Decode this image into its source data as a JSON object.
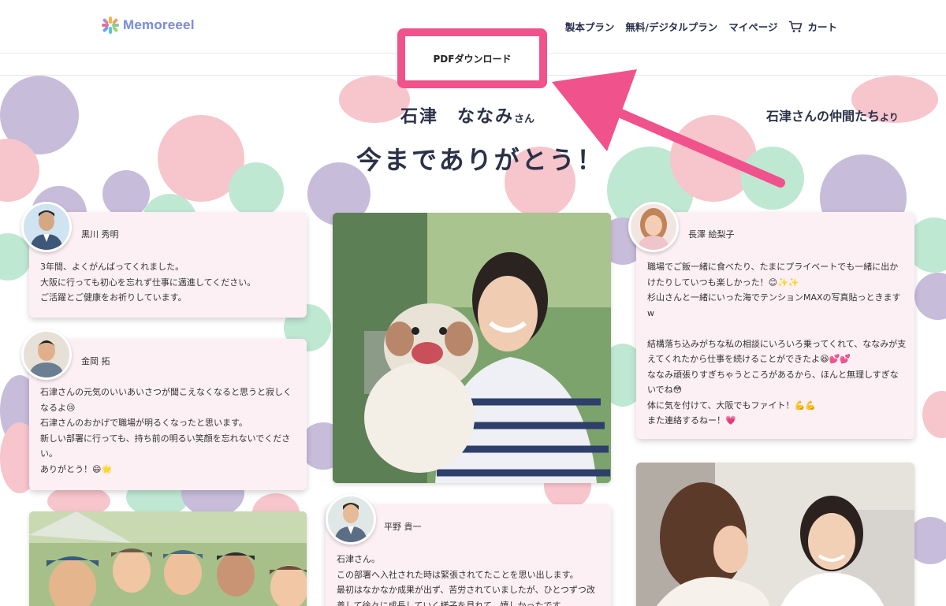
{
  "header": {
    "logo_text": "Memoreeel",
    "nav": [
      "製本プラン",
      "無料/デジタルプラン",
      "マイページ",
      "カート"
    ]
  },
  "pdf_button": "PDFダウンロード",
  "recipient": {
    "name": "石津　ななみ",
    "honorific": "さん"
  },
  "friends_label": {
    "main": "石津さんの仲間たち",
    "suffix": "より"
  },
  "thanks": "今までありがとう！",
  "messages": [
    {
      "author": "黒川 秀明",
      "body": "3年間、よくがんばってくれました。\n大阪に行っても初心を忘れず仕事に邁進してください。\nご活躍とご健康をお祈りしています。"
    },
    {
      "author": "金岡 拓",
      "body": "石津さんの元気のいいあいさつが聞こえなくなると思うと寂しくなるよ😢\n石津さんのおかげで職場が明るくなったと思います。\n新しい部署に行っても、持ち前の明るい笑顔を忘れないでください。\nありがとう！😄🌟"
    },
    {
      "author": "長澤 絵梨子",
      "body": "職場でご飯一緒に食べたり、たまにプライベートでも一緒に出かけたりしていつも楽しかった！😊✨✨\n杉山さんと一緒にいった海でテンションMAXの写真貼っときますw\n\n結構落ち込みがちな私の相談にいろいろ乗ってくれて、ななみが支えてくれたから仕事を続けることができたよ😆💕💕\nななみ頑張りすぎちゃうところがあるから、ほんと無理しすぎないでね😳\n体に気を付けて、大阪でもファイト！💪💪\nまた連絡するねー！💗"
    },
    {
      "author": "平野 貴一",
      "body": "石津さん。\nこの部署へ入社された時は緊張されてたことを思い出します。\n最初はなかなか成果が出ず、苦労されていましたが、ひとつずつ改善して徐々に成長していく様子を見れて、嬉しかったです。"
    }
  ],
  "colors": {
    "accent": "#f0528c",
    "navy": "#2b3148",
    "card_bg": "#fdf0f5",
    "blob_purple": "#c7bcd9",
    "blob_pink": "#f7c5cc",
    "blob_mint": "#bfe8d3"
  }
}
